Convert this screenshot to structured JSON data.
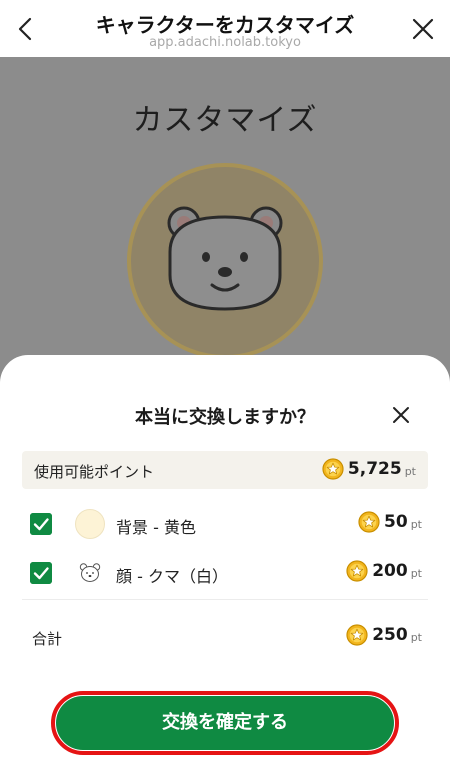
{
  "header": {
    "title": "キャラクターをカスタマイズ",
    "url": "app.adachi.nolab.tokyo"
  },
  "page": {
    "title": "カスタマイズ"
  },
  "modal": {
    "title": "本当に交換しますか？",
    "available_points": {
      "label": "使用可能ポイント",
      "value": "5,725",
      "unit": "pt"
    },
    "items": [
      {
        "checked": true,
        "thumb": "cream-circle",
        "label": "背景 - 黄色",
        "value": "50",
        "unit": "pt"
      },
      {
        "checked": true,
        "thumb": "bear-face-icon",
        "label": "顔 - クマ（白）",
        "value": "200",
        "unit": "pt"
      }
    ],
    "total": {
      "label": "合計",
      "value": "250",
      "unit": "pt"
    },
    "confirm_label": "交換を確定する"
  },
  "colors": {
    "accent_green": "#0f8a42",
    "highlight_red": "#e51414",
    "coin_gold": "#f2b51d"
  }
}
